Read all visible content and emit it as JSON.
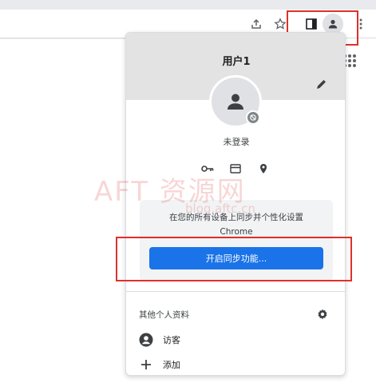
{
  "profile": {
    "name": "用户1",
    "status": "未登录"
  },
  "sync": {
    "description_line1": "在您的所有设备上同步并个性化设置",
    "description_line2": "Chrome",
    "button_label": "开启同步功能..."
  },
  "other_profiles": {
    "title": "其他个人资料",
    "items": [
      {
        "label": "访客",
        "icon": "account-circle-icon"
      },
      {
        "label": "添加",
        "icon": "plus-icon"
      }
    ]
  },
  "watermark": {
    "main": "AFT 资源网",
    "sub": "blog.aftc.cn"
  },
  "colors": {
    "accent": "#1a73e8",
    "highlight": "#e0302b",
    "header_bg": "#e3e3e3"
  }
}
